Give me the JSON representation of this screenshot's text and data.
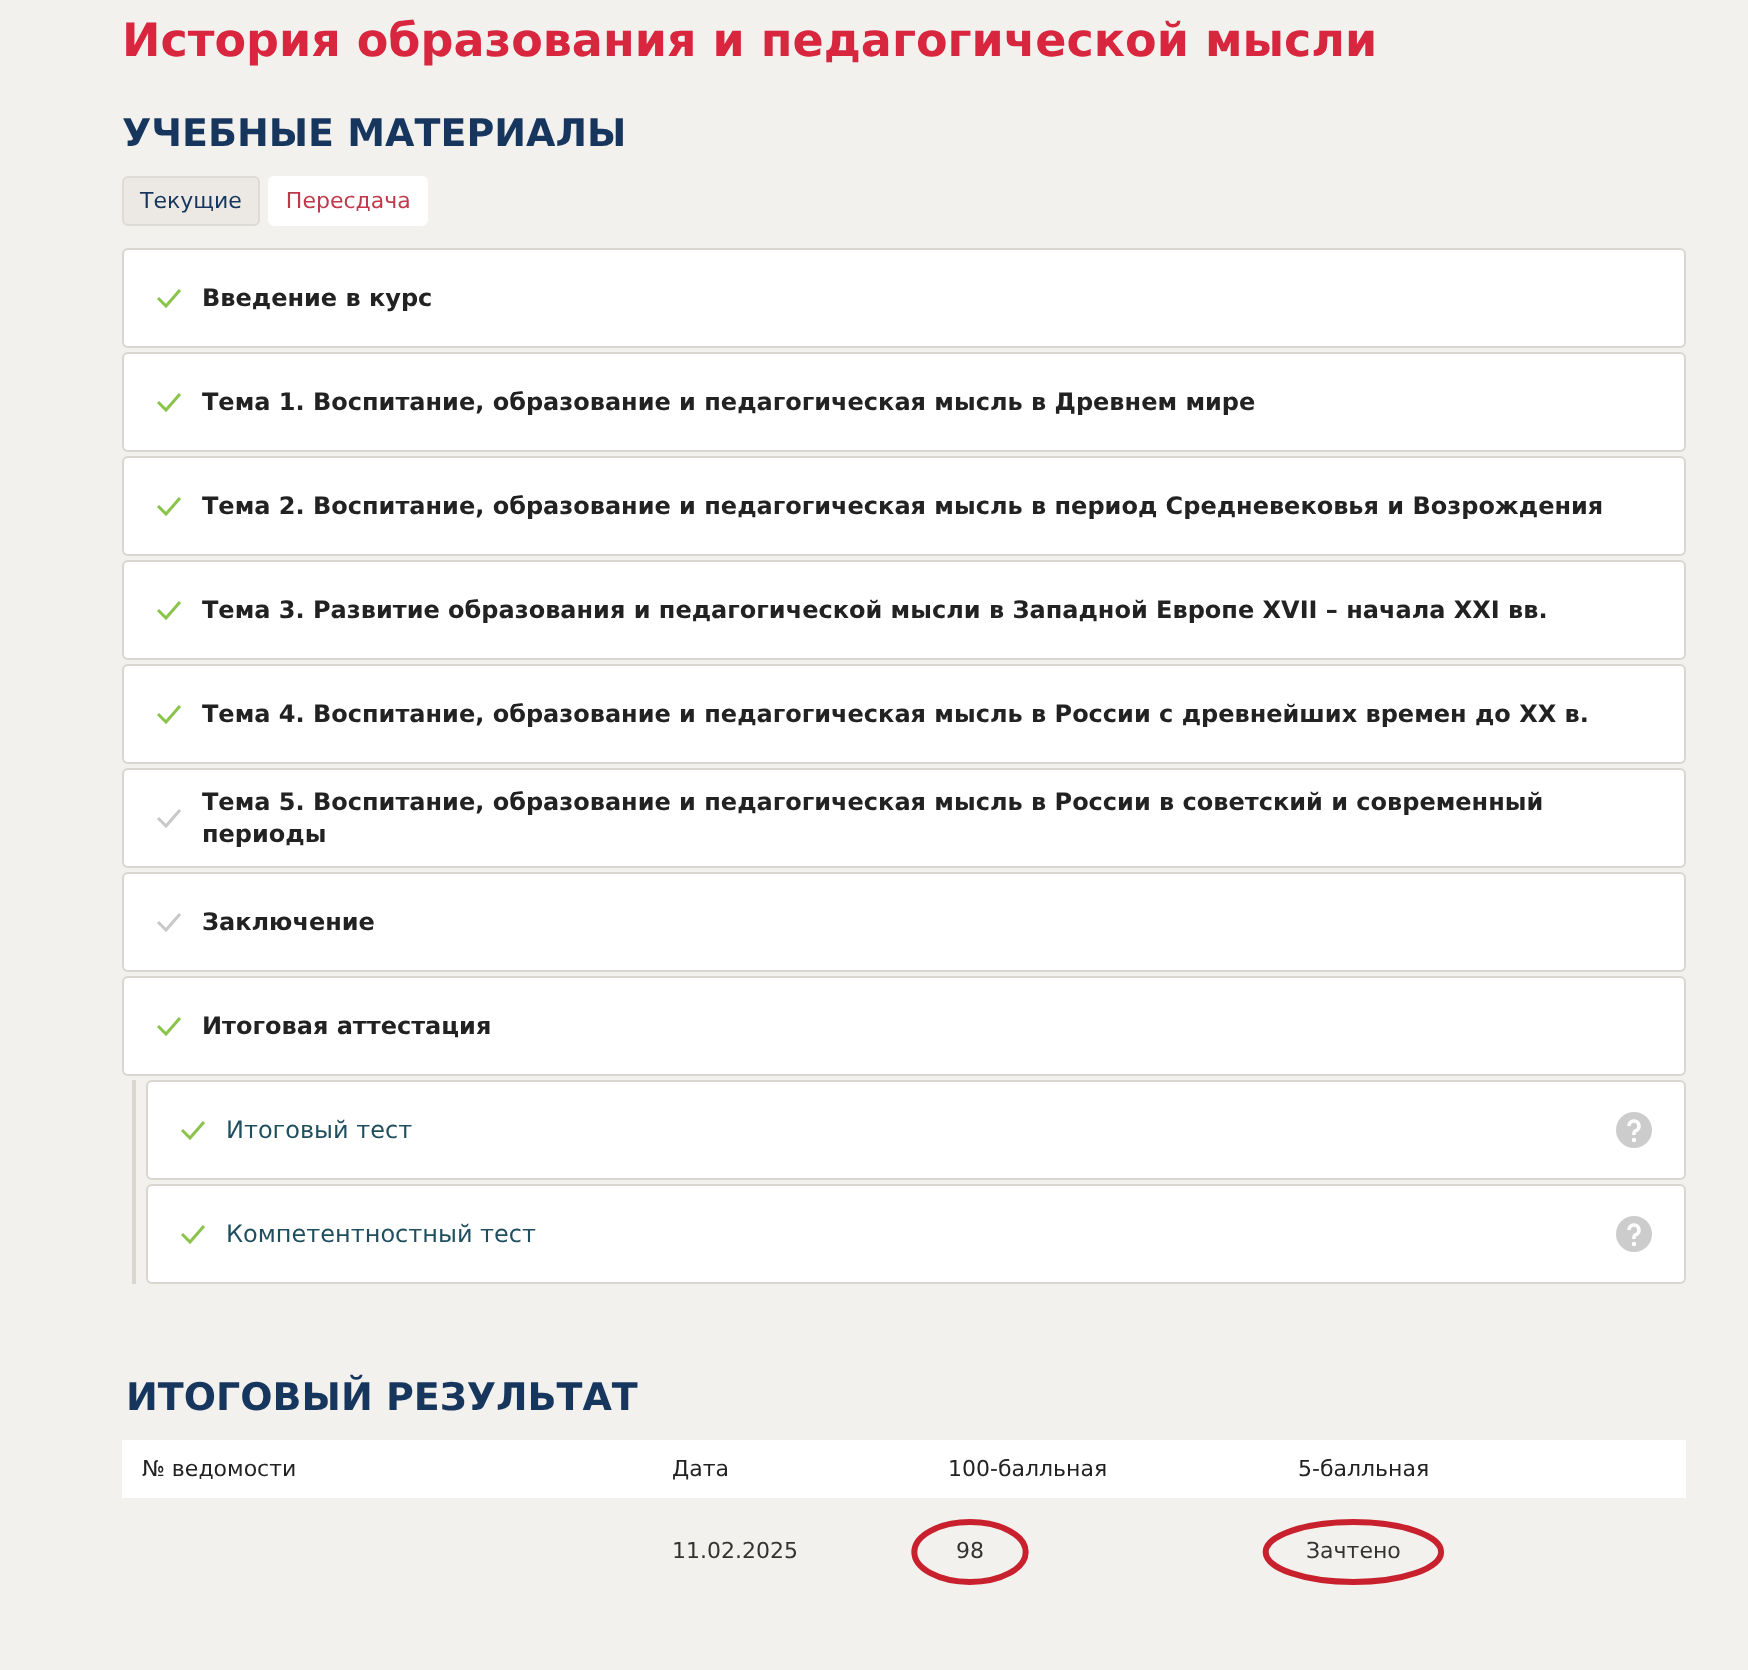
{
  "title": "История образования и педагогической мысли",
  "materials": {
    "heading": "УЧЕБНЫЕ МАТЕРИАЛЫ",
    "tabs": [
      {
        "label": "Текущие",
        "selected": false
      },
      {
        "label": "Пересдача",
        "selected": true
      }
    ],
    "items": [
      {
        "label": "Введение в курс",
        "done": true
      },
      {
        "label": "Тема 1. Воспитание, образование и педагогическая мысль в Древнем мире",
        "done": true
      },
      {
        "label": "Тема 2. Воспитание, образование и педагогическая мысль в период Средневековья и Возрождения",
        "done": true
      },
      {
        "label": "Тема 3. Развитие образования и педагогической мысли в Западной Европе XVII – начала XXI вв.",
        "done": true
      },
      {
        "label": "Тема 4. Воспитание, образование и педагогическая мысль в России с древнейших времен до XX в.",
        "done": true
      },
      {
        "label": "Тема 5. Воспитание, образование и педагогическая мысль в России в советский и современный периоды",
        "done": false
      },
      {
        "label": "Заключение",
        "done": false
      },
      {
        "label": "Итоговая аттестация",
        "done": true,
        "expanded": true,
        "children": [
          {
            "label": "Итоговый тест",
            "done": true
          },
          {
            "label": "Компетентностный тест",
            "done": true
          }
        ]
      }
    ]
  },
  "result": {
    "heading": "ИТОГОВЫЙ РЕЗУЛЬТАТ",
    "columns": [
      "№ ведомости",
      "Дата",
      "100-балльная",
      "5-балльная"
    ],
    "rows": [
      [
        {
          "text": ""
        },
        {
          "text": "11.02.2025",
          "circled": false
        },
        {
          "text": "98",
          "circled": true
        },
        {
          "text": "Зачтено",
          "circled": true
        }
      ]
    ]
  }
}
